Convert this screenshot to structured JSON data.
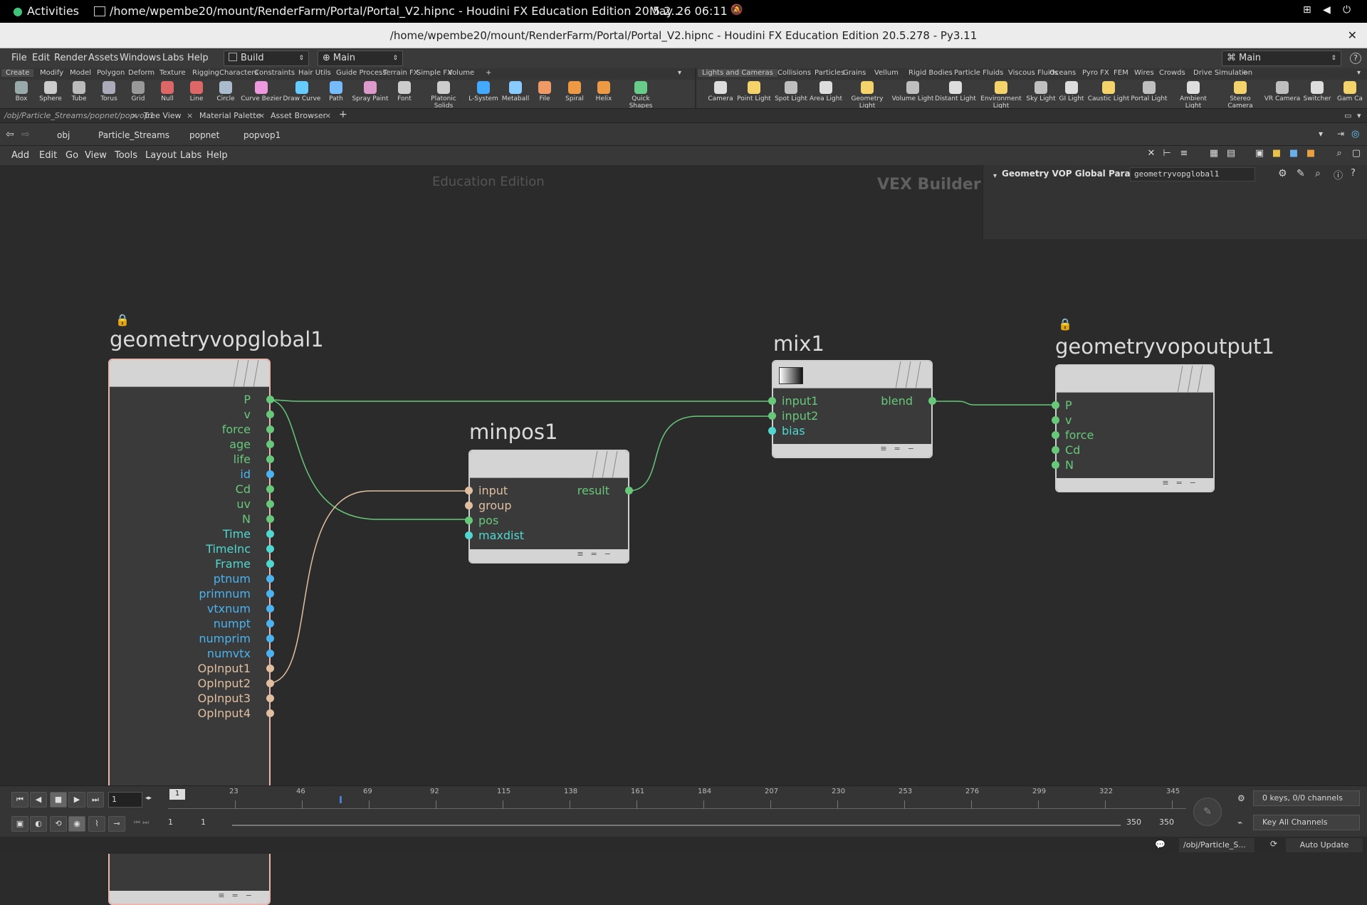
{
  "topbar": {
    "activities": "Activities",
    "window_title": "/home/wpembe20/mount/RenderFarm/Portal/Portal_V2.hipnc - Houdini FX Education Edition 20.5.2...",
    "datetime": "May 26  06:11"
  },
  "titlebar": {
    "title": "/home/wpembe20/mount/RenderFarm/Portal/Portal_V2.hipnc - Houdini FX Education Edition 20.5.278 - Py3.11",
    "close": "✕"
  },
  "menubar": {
    "items": [
      "File",
      "Edit",
      "Render",
      "Assets",
      "Windows",
      "Labs",
      "Help"
    ],
    "desktop": "Build",
    "desktop2": "Main",
    "desktop_right": "Main",
    "help": "?"
  },
  "shelf_tabs_left": [
    "Create",
    "Modify",
    "Model",
    "Polygon",
    "Deform",
    "Texture",
    "Rigging",
    "Characters",
    "Constraints",
    "Hair Utils",
    "Guide Process",
    "Terrain FX",
    "Simple FX",
    "Volume",
    "+"
  ],
  "shelf_tabs_right": [
    "Lights and Cameras",
    "Collisions",
    "Particles",
    "Grains",
    "Vellum",
    "Rigid Bodies",
    "Particle Fluids",
    "Viscous Fluids",
    "Oceans",
    "Pyro FX",
    "FEM",
    "Wires",
    "Crowds",
    "Drive Simulation",
    "+"
  ],
  "tools_left": [
    "Box",
    "Sphere",
    "Tube",
    "Torus",
    "Grid",
    "Null",
    "Line",
    "Circle",
    "Curve Bezier",
    "Draw Curve",
    "Path",
    "Spray Paint",
    "Font",
    "Platonic Solids",
    "L-System",
    "Metaball",
    "File",
    "Spiral",
    "Helix",
    "Quick Shapes"
  ],
  "tools_right": [
    "Camera",
    "Point Light",
    "Spot Light",
    "Area Light",
    "Geometry Light",
    "Volume Light",
    "Distant Light",
    "Environment Light",
    "Sky Light",
    "GI Light",
    "Caustic Light",
    "Portal Light",
    "Ambient Light",
    "Stereo Camera",
    "VR Camera",
    "Switcher",
    "Gam Ca"
  ],
  "pane_tabs": [
    "/obj/Particle_Streams/popnet/popvop1",
    "Tree View",
    "Material Palette",
    "Asset Browser",
    "+"
  ],
  "path": [
    "obj",
    "Particle_Streams",
    "popnet",
    "popvop1"
  ],
  "net_menu": [
    "Add",
    "Edit",
    "Go",
    "View",
    "Tools",
    "Layout",
    "Labs",
    "Help"
  ],
  "watermark": {
    "edu": "Education Edition",
    "context": "VEX Builder"
  },
  "parm_panel": {
    "label": "Geometry VOP Global Parameters",
    "node": "geometryvopglobal1"
  },
  "nodes": {
    "global": {
      "name": "geometryvopglobal1",
      "outputs": [
        "P",
        "v",
        "force",
        "age",
        "life",
        "id",
        "Cd",
        "uv",
        "N",
        "Time",
        "TimeInc",
        "Frame",
        "ptnum",
        "primnum",
        "vtxnum",
        "numpt",
        "numprim",
        "numvtx",
        "OpInput1",
        "OpInput2",
        "OpInput3",
        "OpInput4"
      ]
    },
    "minpos": {
      "name": "minpos1",
      "inputs": [
        "input",
        "group",
        "pos",
        "maxdist"
      ],
      "output": "result"
    },
    "mix": {
      "name": "mix1",
      "inputs": [
        "input1",
        "input2",
        "bias"
      ],
      "output": "blend"
    },
    "output": {
      "name": "geometryvopoutput1",
      "inputs": [
        "P",
        "v",
        "force",
        "Cd",
        "N"
      ]
    }
  },
  "timeline": {
    "frame": "1",
    "start_frame": "1",
    "marker": "1",
    "ticks": [
      "23",
      "46",
      "69",
      "92",
      "115",
      "138",
      "161",
      "184",
      "207",
      "230",
      "253",
      "276",
      "299",
      "322",
      "345"
    ],
    "range_start": "1",
    "range_start2": "1",
    "range_end": "350",
    "range_end2": "350",
    "keys": "0 keys, 0/0 channels",
    "key_mode": "Key All Channels"
  },
  "status": {
    "path": "/obj/Particle_S...",
    "update": "Auto Update"
  },
  "colors": {
    "float": "#67c87a",
    "int": "#4ab3f0",
    "string": "#e0bfa0",
    "bias": "#4fd8d0"
  }
}
